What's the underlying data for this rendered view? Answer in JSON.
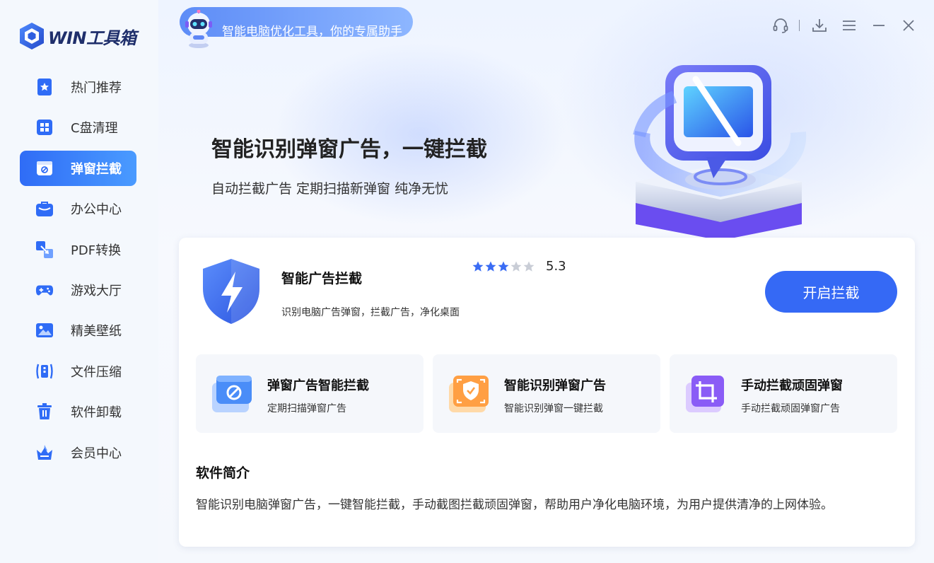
{
  "app": {
    "logo_text": "WIN工具箱"
  },
  "sidebar": {
    "items": [
      {
        "label": "热门推荐",
        "icon": "star-bookmark-icon",
        "active": false
      },
      {
        "label": "C盘清理",
        "icon": "grid-icon",
        "active": false
      },
      {
        "label": "弹窗拦截",
        "icon": "popup-block-icon",
        "active": true
      },
      {
        "label": "办公中心",
        "icon": "briefcase-icon",
        "active": false
      },
      {
        "label": "PDF转换",
        "icon": "convert-icon",
        "active": false
      },
      {
        "label": "游戏大厅",
        "icon": "gamepad-icon",
        "active": false
      },
      {
        "label": "精美壁纸",
        "icon": "image-icon",
        "active": false
      },
      {
        "label": "文件压缩",
        "icon": "compress-icon",
        "active": false
      },
      {
        "label": "软件卸载",
        "icon": "trash-icon",
        "active": false
      },
      {
        "label": "会员中心",
        "icon": "crown-icon",
        "active": false
      }
    ]
  },
  "header": {
    "slogan": "智能电脑优化工具，你的专属助手",
    "controls": [
      "headset-icon",
      "download-icon",
      "menu-icon",
      "minimize-icon",
      "close-icon"
    ]
  },
  "hero": {
    "title": "智能识别弹窗广告，一键拦截",
    "subtitle": "自动拦截广告 定期扫描新弹窗 纯净无忧"
  },
  "card": {
    "name": "智能广告拦截",
    "description": "识别电脑广告弹窗，拦截广告，净化桌面",
    "rating": "5.3",
    "stars_filled": 3,
    "stars_total": 5,
    "button_label": "开启拦截",
    "features": [
      {
        "title": "弹窗广告智能拦截",
        "desc": "定期扫描弹窗广告",
        "icon": "blocked-window-icon"
      },
      {
        "title": "智能识别弹窗广告",
        "desc": "智能识别弹窗一键拦截",
        "icon": "shield-scan-icon"
      },
      {
        "title": "手动拦截顽固弹窗",
        "desc": "手动拦截顽固弹窗广告",
        "icon": "crop-icon"
      }
    ],
    "intro_title": "软件简介",
    "intro_text": "智能识别电脑弹窗广告，一键智能拦截，手动截图拦截顽固弹窗，帮助用户净化电脑环境，为用户提供清净的上网体验。"
  },
  "colors": {
    "accent": "#3569f5",
    "nav_active_start": "#2f6cf6",
    "nav_active_end": "#4a9bff",
    "star_filled": "#3a6cf4",
    "star_empty": "#c9cdd6"
  }
}
